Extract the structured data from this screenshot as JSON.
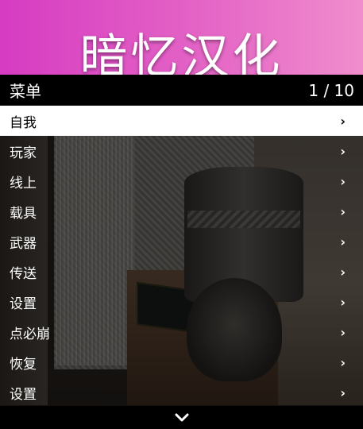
{
  "banner": {
    "title": "暗忆汉化",
    "gradient_start": "#d63bc2",
    "gradient_end": "#f08ecd"
  },
  "menu": {
    "title": "菜单",
    "position": "1 / 10",
    "selected_index": 0,
    "items": [
      {
        "label": "自我",
        "icon": "chevron-right-icon"
      },
      {
        "label": "玩家",
        "icon": "chevron-right-icon"
      },
      {
        "label": "线上",
        "icon": "chevron-right-icon"
      },
      {
        "label": "载具",
        "icon": "chevron-right-icon"
      },
      {
        "label": "武器",
        "icon": "chevron-right-icon"
      },
      {
        "label": "传送",
        "icon": "chevron-right-icon"
      },
      {
        "label": "设置",
        "icon": "chevron-right-icon"
      },
      {
        "label": "点必崩",
        "icon": "chevron-right-icon"
      },
      {
        "label": "恢复",
        "icon": "chevron-right-icon"
      },
      {
        "label": "设置",
        "icon": "chevron-right-icon"
      }
    ],
    "footer_icon": "chevron-down-icon"
  }
}
